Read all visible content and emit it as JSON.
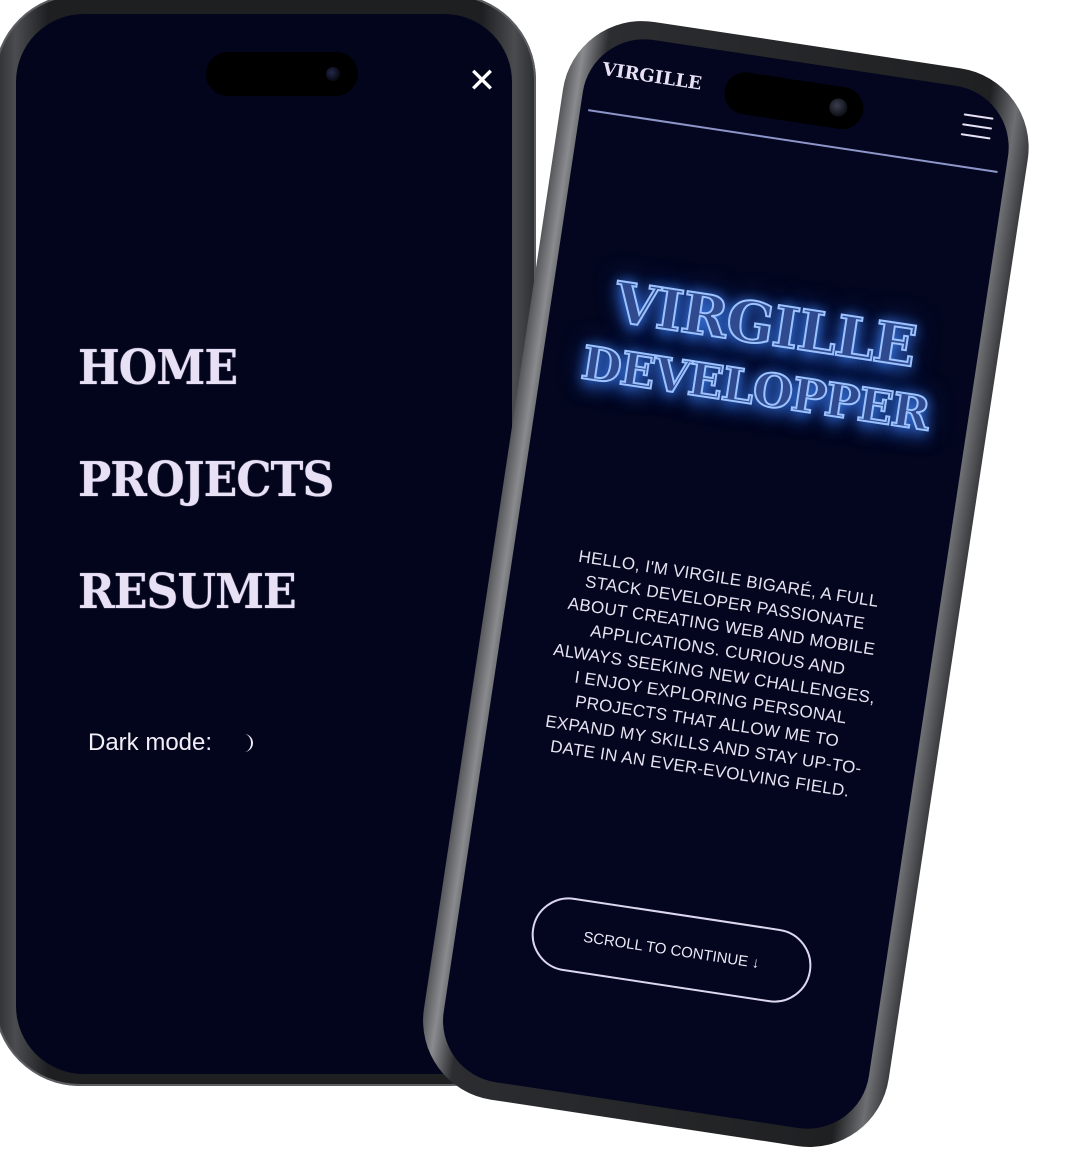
{
  "menu_screen": {
    "close_symbol": "✕",
    "nav_items": [
      "HOME",
      "PROJECTS",
      "RESUME"
    ],
    "dark_mode_label": "Dark mode:",
    "dark_mode_icon": "moon-icon"
  },
  "home_screen": {
    "brand": "VIRGILLE",
    "menu_icon": "hamburger-icon",
    "hero_line1": "VIRGILLE",
    "hero_line2": "DEVELOPPER",
    "intro": "HELLO, I'M VIRGILE BIGARÉ, A FULL STACK DEVELOPER PASSIONATE ABOUT CREATING WEB AND MOBILE APPLICATIONS. CURIOUS AND ALWAYS SEEKING NEW CHALLENGES, I ENJOY EXPLORING PERSONAL PROJECTS THAT ALLOW ME TO EXPAND MY SKILLS AND STAY UP-TO-DATE IN AN EVER-EVOLVING FIELD.",
    "scroll_label": "SCROLL TO CONTINUE ↓"
  },
  "colors": {
    "screen_bg": "#03051c",
    "text_light": "#e8e0f5",
    "hero_glow": "#3b78e0",
    "divider": "#8d95c9"
  }
}
